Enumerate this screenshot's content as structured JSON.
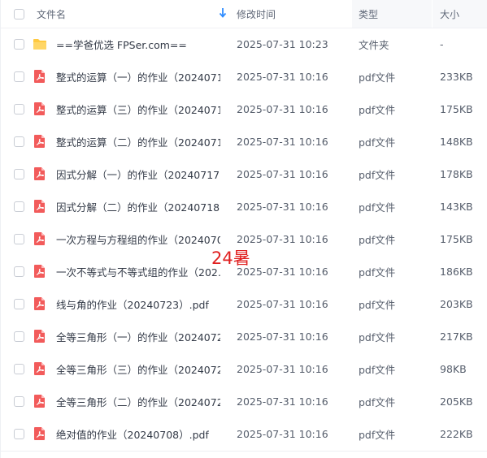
{
  "header": {
    "name_label": "文件名",
    "time_label": "修改时间",
    "type_label": "类型",
    "size_label": "大小",
    "sort_icon": "arrow-down-icon"
  },
  "files": [
    {
      "name": "==学爸优选 FPSer.com==",
      "time": "2025-07-31 10:23",
      "type": "文件夹",
      "size": "-",
      "icon": "folder-icon"
    },
    {
      "name": "整式的运算（一）的作业（2024071…",
      "time": "2025-07-31 10:16",
      "type": "pdf文件",
      "size": "233KB",
      "icon": "pdf-icon"
    },
    {
      "name": "整式的运算（三）的作业（2024071…",
      "time": "2025-07-31 10:16",
      "type": "pdf文件",
      "size": "175KB",
      "icon": "pdf-icon"
    },
    {
      "name": "整式的运算（二）的作业（2024071…",
      "time": "2025-07-31 10:16",
      "type": "pdf文件",
      "size": "148KB",
      "icon": "pdf-icon"
    },
    {
      "name": "因式分解（一）的作业（20240717…",
      "time": "2025-07-31 10:16",
      "type": "pdf文件",
      "size": "178KB",
      "icon": "pdf-icon"
    },
    {
      "name": "因式分解（二）的作业（20240718…",
      "time": "2025-07-31 10:16",
      "type": "pdf文件",
      "size": "143KB",
      "icon": "pdf-icon"
    },
    {
      "name": "一次方程与方程组的作业（2024070…",
      "time": "2025-07-31 10:16",
      "type": "pdf文件",
      "size": "175KB",
      "icon": "pdf-icon"
    },
    {
      "name": "一次不等式与不等式组的作业（202…",
      "time": "2025-07-31 10:16",
      "type": "pdf文件",
      "size": "186KB",
      "icon": "pdf-icon"
    },
    {
      "name": "线与角的作业（20240723）.pdf",
      "time": "2025-07-31 10:16",
      "type": "pdf文件",
      "size": "203KB",
      "icon": "pdf-icon"
    },
    {
      "name": "全等三角形（一）的作业（2024072…",
      "time": "2025-07-31 10:16",
      "type": "pdf文件",
      "size": "217KB",
      "icon": "pdf-icon"
    },
    {
      "name": "全等三角形（三）的作业（2024072…",
      "time": "2025-07-31 10:16",
      "type": "pdf文件",
      "size": "98KB",
      "icon": "pdf-icon"
    },
    {
      "name": "全等三角形（二）的作业（2024072…",
      "time": "2025-07-31 10:16",
      "type": "pdf文件",
      "size": "205KB",
      "icon": "pdf-icon"
    },
    {
      "name": "绝对值的作业（20240708）.pdf",
      "time": "2025-07-31 10:16",
      "type": "pdf文件",
      "size": "222KB",
      "icon": "pdf-icon"
    }
  ],
  "watermark": "24暑",
  "colors": {
    "pdf": "#f25b5b",
    "folder": "#ffc940",
    "accent": "#2f8cff",
    "watermark": "#e02020"
  }
}
